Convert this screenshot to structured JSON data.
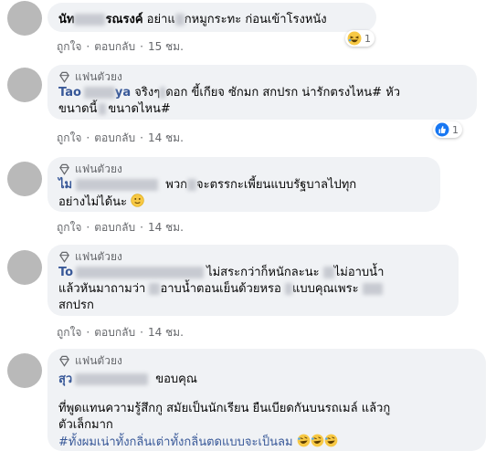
{
  "comments": [
    {
      "name": "นัท",
      "name_tail": "รณรงค์",
      "text": " อย่าแ",
      "text2": "กหมูกระทะ ก่อนเข้าโรงหนัง",
      "like": "ถูกใจ",
      "reply": "ตอบกลับ",
      "time": "15 ชม.",
      "reaction_count": "1",
      "reaction_icon": "laugh-emoji"
    },
    {
      "fan_label": "แฟนตัวยง",
      "name": "Tao",
      "name_tail": "ya",
      "line1": "จริงๆ",
      "line1b": "ดอก ขี้เกียจ ซักมก สกปรก น่ารักตรงไหน# หัว",
      "line2a": "ขนาดนี้",
      "line2b": "ขนาดไหน#",
      "like": "ถูกใจ",
      "reply": "ตอบกลับ",
      "time": "14 ชม.",
      "reaction_count": "1",
      "reaction_icon": "like-icon"
    },
    {
      "fan_label": "แฟนตัวยง",
      "name": "ไม",
      "line1": "พวก",
      "line1b": "จะตรรกะเพี้ยนแบบรัฐบาลไปทุก",
      "line2": "อย่างไม่ได้นะ",
      "like": "ถูกใจ",
      "reply": "ตอบกลับ",
      "time": "14 ชม."
    },
    {
      "fan_label": "แฟนตัวยง",
      "name": "To",
      "line1": "ไม่สระกว่าก็หนักละนะ",
      "line1b": "ไม่อาบน้ำ",
      "line2a": "แล้วหันมาถามว่า",
      "line2b": "อาบน้ำตอนเย็นด้วยหรอ",
      "line2c": "แบบคุณเพระ",
      "line3": "สกปรก",
      "like": "ถูกใจ",
      "reply": "ตอบกลับ",
      "time": "14 ชม."
    },
    {
      "fan_label": "แฟนตัวยง",
      "name": "สุว",
      "name_after": "ขอบคุณ",
      "line1": "ที่พูดแทนความรู้สึกกู สมัยเป็นนักเรียน ยืนเบียดกันบนรถเมล์ แล้วกู",
      "line2": "ตัวเล็กมาก",
      "hashtag": "#ทั้งผมเน่าทั้งกลิ่นเต่าทั้งกลิ่นตดแบบจะเป็นลม"
    }
  ],
  "colors": {
    "bubble": "#f0f2f5",
    "link": "#385898",
    "meta": "#65676b",
    "like_blue": "#1877f2"
  }
}
